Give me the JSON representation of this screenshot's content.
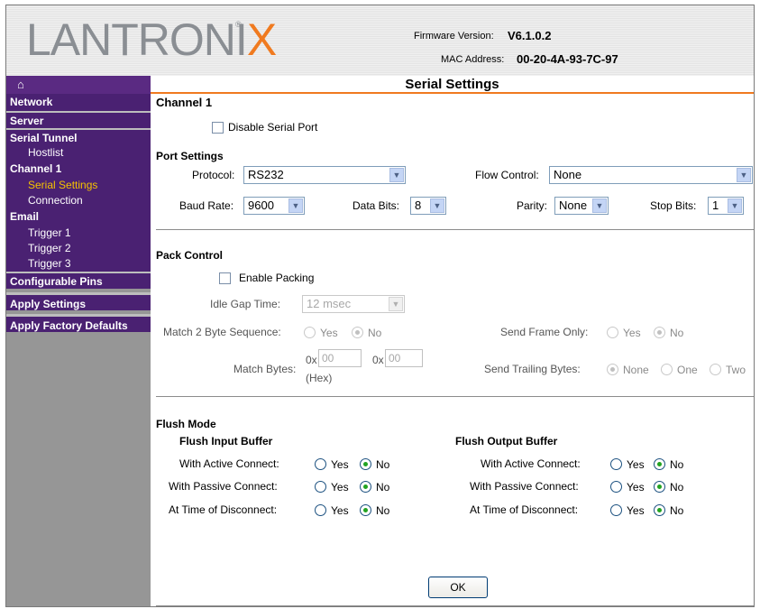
{
  "header": {
    "logo_main": "LANTRONI",
    "logo_x": "X",
    "logo_reg": "®",
    "firmware_label": "Firmware Version:",
    "firmware_value": "V6.1.0.2",
    "mac_label": "MAC Address:",
    "mac_value": "00-20-4A-93-7C-97"
  },
  "sidebar": {
    "home_icon": "⌂",
    "network": "Network",
    "server": "Server",
    "serial_tunnel": "Serial Tunnel",
    "hostlist": "Hostlist",
    "channel1": "Channel 1",
    "serial_settings": "Serial Settings",
    "connection": "Connection",
    "email": "Email",
    "trigger1": "Trigger 1",
    "trigger2": "Trigger 2",
    "trigger3": "Trigger 3",
    "configurable_pins": "Configurable Pins",
    "apply_settings": "Apply Settings",
    "apply_factory_defaults": "Apply Factory Defaults"
  },
  "main": {
    "title": "Serial Settings",
    "channel": "Channel 1",
    "disable_serial_port": "Disable Serial Port",
    "port_settings": {
      "heading": "Port Settings",
      "protocol_label": "Protocol:",
      "protocol_value": "RS232",
      "flow_control_label": "Flow Control:",
      "flow_control_value": "None",
      "baud_rate_label": "Baud Rate:",
      "baud_rate_value": "9600",
      "data_bits_label": "Data Bits:",
      "data_bits_value": "8",
      "parity_label": "Parity:",
      "parity_value": "None",
      "stop_bits_label": "Stop Bits:",
      "stop_bits_value": "1"
    },
    "pack_control": {
      "heading": "Pack Control",
      "enable_packing": "Enable Packing",
      "idle_gap_label": "Idle Gap Time:",
      "idle_gap_value": "12 msec",
      "match2_label": "Match 2 Byte Sequence:",
      "send_frame_only_label": "Send Frame Only:",
      "yes": "Yes",
      "no": "No",
      "match_bytes_label": "Match Bytes:",
      "hex_prefix": "0x",
      "match_byte1": "00",
      "match_byte2": "00",
      "hex_note": "(Hex)",
      "send_trailing_label": "Send Trailing Bytes:",
      "none": "None",
      "one": "One",
      "two": "Two"
    },
    "flush_mode": {
      "heading": "Flush Mode",
      "input_heading": "Flush Input Buffer",
      "output_heading": "Flush Output Buffer",
      "active_connect": "With Active Connect:",
      "passive_connect": "With Passive Connect:",
      "disconnect": "At Time of Disconnect:",
      "yes": "Yes",
      "no": "No"
    },
    "ok": "OK"
  }
}
